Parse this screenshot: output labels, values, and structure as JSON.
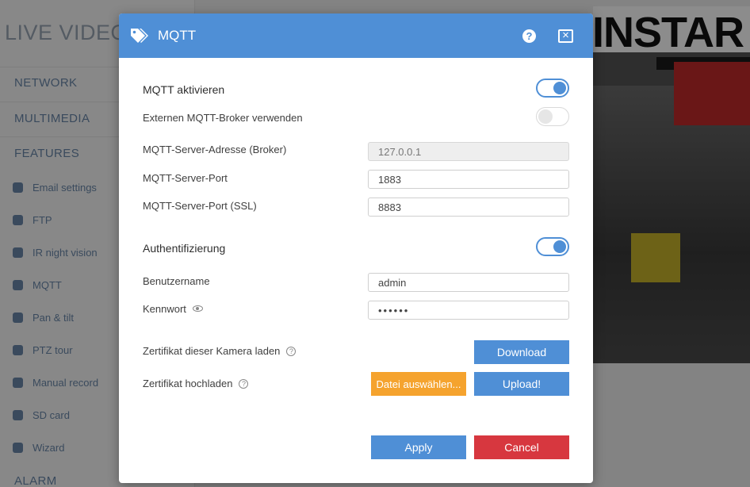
{
  "background": {
    "app_title": "LIVE VIDEO",
    "sections": [
      "NETWORK",
      "MULTIMEDIA",
      "FEATURES"
    ],
    "items": [
      "Email settings",
      "FTP",
      "IR night vision",
      "MQTT",
      "Pan & tilt",
      "PTZ tour",
      "Manual record",
      "SD card",
      "Wizard"
    ],
    "footer_section": "ALARM",
    "logo": "INSTAR"
  },
  "modal": {
    "title": "MQTT",
    "icon": "tag-icon",
    "help_glyph": "?",
    "close_glyph": "×",
    "mqtt_enable": {
      "label": "MQTT aktivieren",
      "on": true
    },
    "external_broker": {
      "label": "Externen MQTT-Broker verwenden",
      "on": false
    },
    "server_address": {
      "label": "MQTT-Server-Adresse (Broker)",
      "value": "127.0.0.1",
      "disabled": true
    },
    "server_port": {
      "label": "MQTT-Server-Port",
      "value": "1883"
    },
    "server_port_ssl": {
      "label": "MQTT-Server-Port (SSL)",
      "value": "8883"
    },
    "auth": {
      "label": "Authentifizierung",
      "on": true
    },
    "username": {
      "label": "Benutzername",
      "value": "admin"
    },
    "password": {
      "label": "Kennwort",
      "value": "••••••"
    },
    "cert_download": {
      "label": "Zertifikat dieser Kamera laden",
      "button": "Download"
    },
    "cert_upload": {
      "label": "Zertifikat hochladen",
      "choose_button": "Datei auswählen...",
      "upload_button": "Upload!"
    },
    "apply_button": "Apply",
    "cancel_button": "Cancel"
  },
  "colors": {
    "accent": "#4f8fd6",
    "orange": "#f5a32e",
    "danger": "#d7373f"
  }
}
